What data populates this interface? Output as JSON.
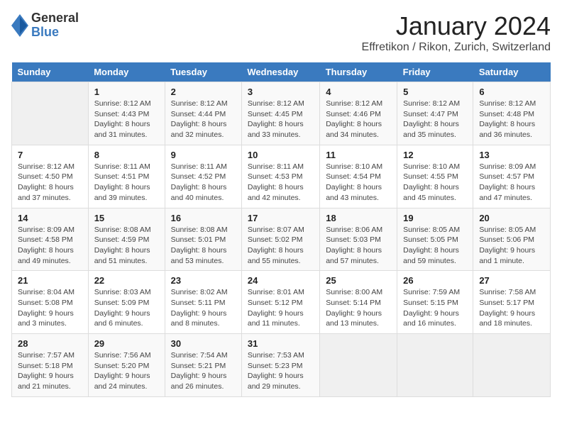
{
  "header": {
    "logo_general": "General",
    "logo_blue": "Blue",
    "month_title": "January 2024",
    "location": "Effretikon / Rikon, Zurich, Switzerland"
  },
  "calendar": {
    "headers": [
      "Sunday",
      "Monday",
      "Tuesday",
      "Wednesday",
      "Thursday",
      "Friday",
      "Saturday"
    ],
    "weeks": [
      [
        {
          "day": "",
          "sunrise": "",
          "sunset": "",
          "daylight": ""
        },
        {
          "day": "1",
          "sunrise": "Sunrise: 8:12 AM",
          "sunset": "Sunset: 4:43 PM",
          "daylight": "Daylight: 8 hours and 31 minutes."
        },
        {
          "day": "2",
          "sunrise": "Sunrise: 8:12 AM",
          "sunset": "Sunset: 4:44 PM",
          "daylight": "Daylight: 8 hours and 32 minutes."
        },
        {
          "day": "3",
          "sunrise": "Sunrise: 8:12 AM",
          "sunset": "Sunset: 4:45 PM",
          "daylight": "Daylight: 8 hours and 33 minutes."
        },
        {
          "day": "4",
          "sunrise": "Sunrise: 8:12 AM",
          "sunset": "Sunset: 4:46 PM",
          "daylight": "Daylight: 8 hours and 34 minutes."
        },
        {
          "day": "5",
          "sunrise": "Sunrise: 8:12 AM",
          "sunset": "Sunset: 4:47 PM",
          "daylight": "Daylight: 8 hours and 35 minutes."
        },
        {
          "day": "6",
          "sunrise": "Sunrise: 8:12 AM",
          "sunset": "Sunset: 4:48 PM",
          "daylight": "Daylight: 8 hours and 36 minutes."
        }
      ],
      [
        {
          "day": "7",
          "sunrise": "Sunrise: 8:12 AM",
          "sunset": "Sunset: 4:50 PM",
          "daylight": "Daylight: 8 hours and 37 minutes."
        },
        {
          "day": "8",
          "sunrise": "Sunrise: 8:11 AM",
          "sunset": "Sunset: 4:51 PM",
          "daylight": "Daylight: 8 hours and 39 minutes."
        },
        {
          "day": "9",
          "sunrise": "Sunrise: 8:11 AM",
          "sunset": "Sunset: 4:52 PM",
          "daylight": "Daylight: 8 hours and 40 minutes."
        },
        {
          "day": "10",
          "sunrise": "Sunrise: 8:11 AM",
          "sunset": "Sunset: 4:53 PM",
          "daylight": "Daylight: 8 hours and 42 minutes."
        },
        {
          "day": "11",
          "sunrise": "Sunrise: 8:10 AM",
          "sunset": "Sunset: 4:54 PM",
          "daylight": "Daylight: 8 hours and 43 minutes."
        },
        {
          "day": "12",
          "sunrise": "Sunrise: 8:10 AM",
          "sunset": "Sunset: 4:55 PM",
          "daylight": "Daylight: 8 hours and 45 minutes."
        },
        {
          "day": "13",
          "sunrise": "Sunrise: 8:09 AM",
          "sunset": "Sunset: 4:57 PM",
          "daylight": "Daylight: 8 hours and 47 minutes."
        }
      ],
      [
        {
          "day": "14",
          "sunrise": "Sunrise: 8:09 AM",
          "sunset": "Sunset: 4:58 PM",
          "daylight": "Daylight: 8 hours and 49 minutes."
        },
        {
          "day": "15",
          "sunrise": "Sunrise: 8:08 AM",
          "sunset": "Sunset: 4:59 PM",
          "daylight": "Daylight: 8 hours and 51 minutes."
        },
        {
          "day": "16",
          "sunrise": "Sunrise: 8:08 AM",
          "sunset": "Sunset: 5:01 PM",
          "daylight": "Daylight: 8 hours and 53 minutes."
        },
        {
          "day": "17",
          "sunrise": "Sunrise: 8:07 AM",
          "sunset": "Sunset: 5:02 PM",
          "daylight": "Daylight: 8 hours and 55 minutes."
        },
        {
          "day": "18",
          "sunrise": "Sunrise: 8:06 AM",
          "sunset": "Sunset: 5:03 PM",
          "daylight": "Daylight: 8 hours and 57 minutes."
        },
        {
          "day": "19",
          "sunrise": "Sunrise: 8:05 AM",
          "sunset": "Sunset: 5:05 PM",
          "daylight": "Daylight: 8 hours and 59 minutes."
        },
        {
          "day": "20",
          "sunrise": "Sunrise: 8:05 AM",
          "sunset": "Sunset: 5:06 PM",
          "daylight": "Daylight: 9 hours and 1 minute."
        }
      ],
      [
        {
          "day": "21",
          "sunrise": "Sunrise: 8:04 AM",
          "sunset": "Sunset: 5:08 PM",
          "daylight": "Daylight: 9 hours and 3 minutes."
        },
        {
          "day": "22",
          "sunrise": "Sunrise: 8:03 AM",
          "sunset": "Sunset: 5:09 PM",
          "daylight": "Daylight: 9 hours and 6 minutes."
        },
        {
          "day": "23",
          "sunrise": "Sunrise: 8:02 AM",
          "sunset": "Sunset: 5:11 PM",
          "daylight": "Daylight: 9 hours and 8 minutes."
        },
        {
          "day": "24",
          "sunrise": "Sunrise: 8:01 AM",
          "sunset": "Sunset: 5:12 PM",
          "daylight": "Daylight: 9 hours and 11 minutes."
        },
        {
          "day": "25",
          "sunrise": "Sunrise: 8:00 AM",
          "sunset": "Sunset: 5:14 PM",
          "daylight": "Daylight: 9 hours and 13 minutes."
        },
        {
          "day": "26",
          "sunrise": "Sunrise: 7:59 AM",
          "sunset": "Sunset: 5:15 PM",
          "daylight": "Daylight: 9 hours and 16 minutes."
        },
        {
          "day": "27",
          "sunrise": "Sunrise: 7:58 AM",
          "sunset": "Sunset: 5:17 PM",
          "daylight": "Daylight: 9 hours and 18 minutes."
        }
      ],
      [
        {
          "day": "28",
          "sunrise": "Sunrise: 7:57 AM",
          "sunset": "Sunset: 5:18 PM",
          "daylight": "Daylight: 9 hours and 21 minutes."
        },
        {
          "day": "29",
          "sunrise": "Sunrise: 7:56 AM",
          "sunset": "Sunset: 5:20 PM",
          "daylight": "Daylight: 9 hours and 24 minutes."
        },
        {
          "day": "30",
          "sunrise": "Sunrise: 7:54 AM",
          "sunset": "Sunset: 5:21 PM",
          "daylight": "Daylight: 9 hours and 26 minutes."
        },
        {
          "day": "31",
          "sunrise": "Sunrise: 7:53 AM",
          "sunset": "Sunset: 5:23 PM",
          "daylight": "Daylight: 9 hours and 29 minutes."
        },
        {
          "day": "",
          "sunrise": "",
          "sunset": "",
          "daylight": ""
        },
        {
          "day": "",
          "sunrise": "",
          "sunset": "",
          "daylight": ""
        },
        {
          "day": "",
          "sunrise": "",
          "sunset": "",
          "daylight": ""
        }
      ]
    ]
  }
}
